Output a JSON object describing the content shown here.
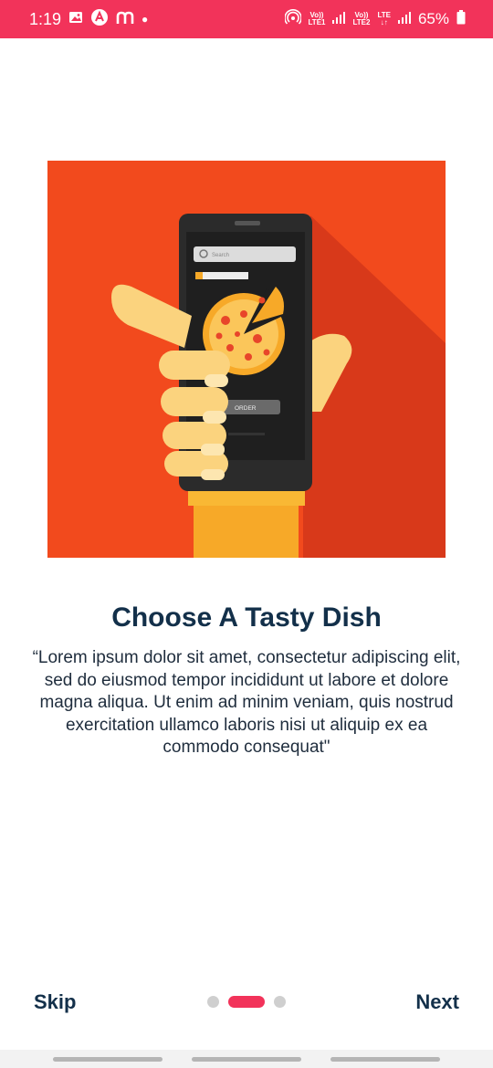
{
  "status_bar": {
    "time": "1:19",
    "left_icons": [
      "image-icon",
      "a-circle-icon",
      "m-icon"
    ],
    "network": {
      "sim1_label_top": "Vo))",
      "sim1_label_bottom": "LTE1",
      "sim2_label_top": "Vo))",
      "sim2_label_bottom": "LTE2",
      "lte_label": "LTE"
    },
    "battery": "65%"
  },
  "colors": {
    "status_bar": "#f2335a",
    "accent": "#f2335a",
    "title": "#13304a",
    "illustration_bg": "#f24a1d",
    "dot_inactive": "#cfcfcf"
  },
  "illustration": {
    "icon": "phone-pizza-order-illustration",
    "search_placeholder": "Search",
    "order_label": "ORDER"
  },
  "onboarding": {
    "title": "Choose A Tasty Dish",
    "description": "“Lorem ipsum dolor sit amet, consectetur adipiscing elit, sed do eiusmod tempor incididunt ut labore et dolore magna aliqua. Ut enim ad minim veniam, quis nostrud exercitation ullamco laboris nisi ut aliquip ex ea commodo consequat\"",
    "pages_total": 3,
    "current_page": 2
  },
  "footer": {
    "skip_label": "Skip",
    "next_label": "Next"
  }
}
